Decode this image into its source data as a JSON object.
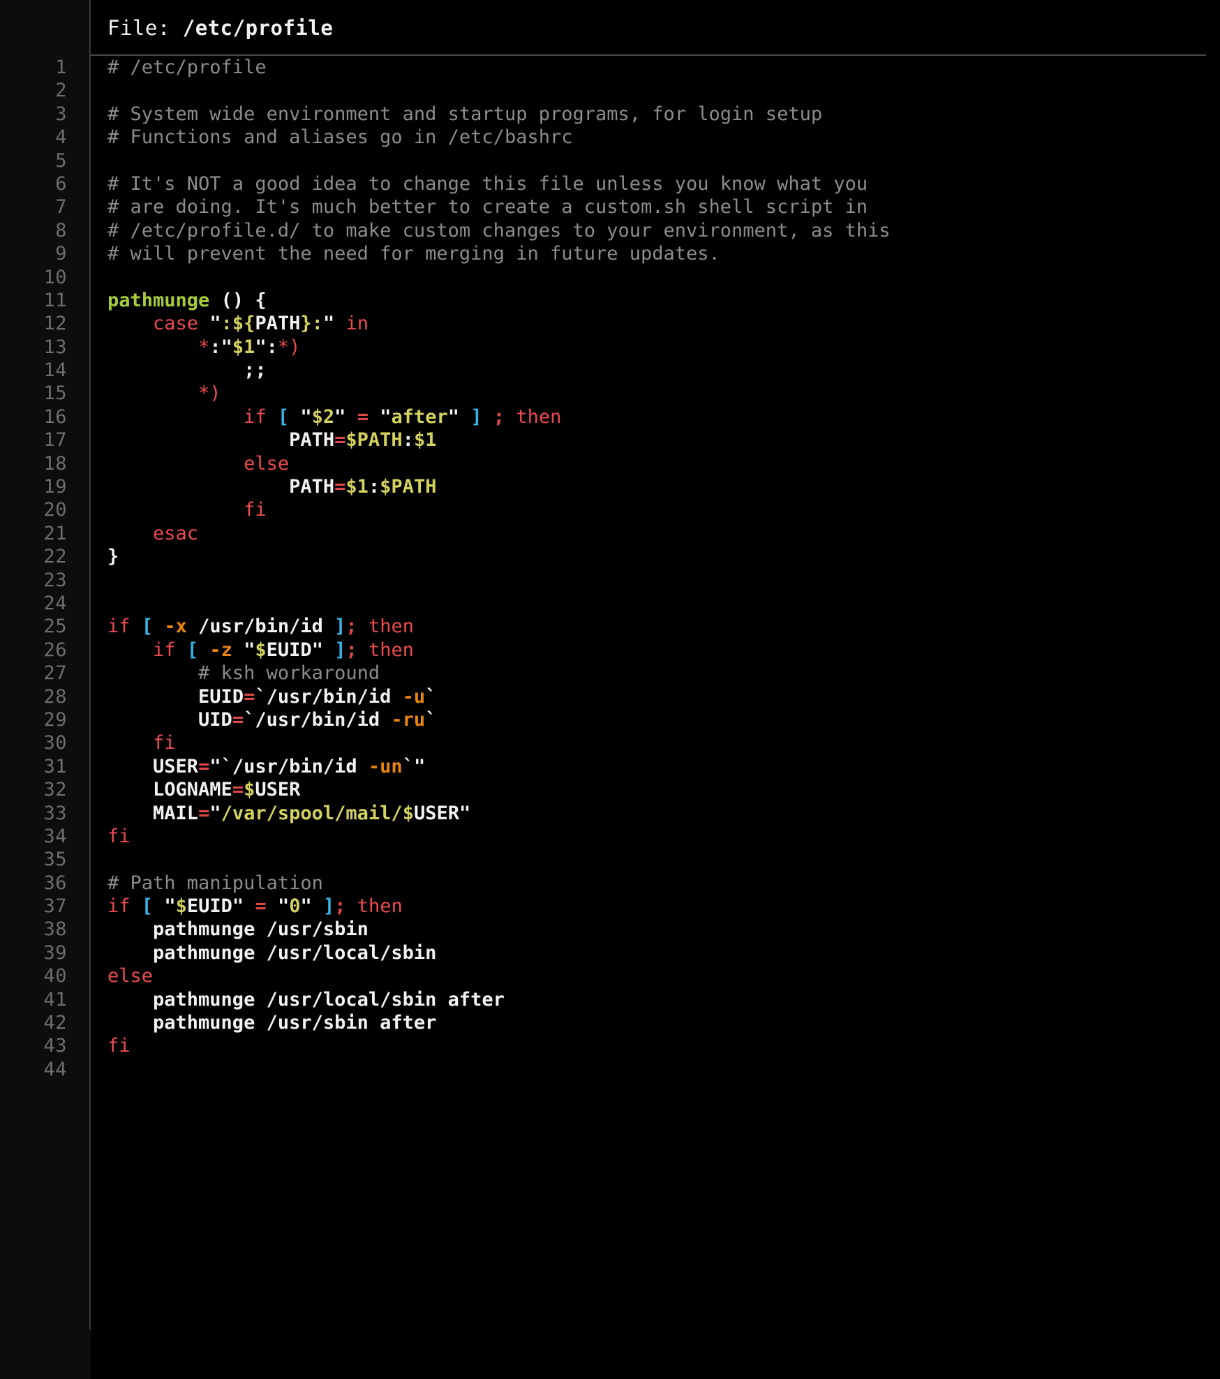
{
  "header": {
    "label": "File: ",
    "path": "/etc/profile",
    "full": "File: /etc/profile"
  },
  "theme": {
    "page_background": "#000000",
    "gutter_background": "#0d0d0d",
    "gutter_rule": "#3a3a3a",
    "header_rule": "#4a4a4a",
    "line_number": "#6e6e6e",
    "comment": "#8c8c8c",
    "plain_text": "#f2f2f2",
    "function_name": "#a6cd38",
    "keyword": "#ed4a50",
    "string": "#d4d25e",
    "variable_sigil": "#d4d25e",
    "bracket": "#35b5e8",
    "operator": "#e04848",
    "flag": "#e88410"
  },
  "editor": {
    "first_line": 1,
    "last_line": 44,
    "total_lines": 44,
    "language": "bash"
  },
  "line_numbers": [
    "1",
    "2",
    "3",
    "4",
    "5",
    "6",
    "7",
    "8",
    "9",
    "10",
    "11",
    "12",
    "13",
    "14",
    "15",
    "16",
    "17",
    "18",
    "19",
    "20",
    "21",
    "22",
    "23",
    "24",
    "25",
    "26",
    "27",
    "28",
    "29",
    "30",
    "31",
    "32",
    "33",
    "34",
    "35",
    "36",
    "37",
    "38",
    "39",
    "40",
    "41",
    "42",
    "43",
    "44"
  ],
  "lines": [
    {
      "n": 1,
      "text": "# /etc/profile",
      "tokens": [
        {
          "t": "# /etc/profile",
          "c": "comment"
        }
      ]
    },
    {
      "n": 2,
      "text": "",
      "tokens": []
    },
    {
      "n": 3,
      "text": "# System wide environment and startup programs, for login setup",
      "tokens": [
        {
          "t": "# System wide environment and startup programs, for login setup",
          "c": "comment"
        }
      ]
    },
    {
      "n": 4,
      "text": "# Functions and aliases go in /etc/bashrc",
      "tokens": [
        {
          "t": "# Functions and aliases go in /etc/bashrc",
          "c": "comment"
        }
      ]
    },
    {
      "n": 5,
      "text": "",
      "tokens": []
    },
    {
      "n": 6,
      "text": "# It's NOT a good idea to change this file unless you know what you",
      "tokens": [
        {
          "t": "# It's NOT a good idea to change this file unless you know what you",
          "c": "comment"
        }
      ]
    },
    {
      "n": 7,
      "text": "# are doing. It's much better to create a custom.sh shell script in",
      "tokens": [
        {
          "t": "# are doing. It's much better to create a custom.sh shell script in",
          "c": "comment"
        }
      ]
    },
    {
      "n": 8,
      "text": "# /etc/profile.d/ to make custom changes to your environment, as this",
      "tokens": [
        {
          "t": "# /etc/profile.d/ to make custom changes to your environment, as this",
          "c": "comment"
        }
      ]
    },
    {
      "n": 9,
      "text": "# will prevent the need for merging in future updates.",
      "tokens": [
        {
          "t": "# will prevent the need for merging in future updates.",
          "c": "comment"
        }
      ]
    },
    {
      "n": 10,
      "text": "",
      "tokens": []
    },
    {
      "n": 11,
      "text": "pathmunge () {",
      "tokens": [
        {
          "t": "pathmunge",
          "c": "func"
        },
        {
          "t": " () {",
          "c": "plain"
        }
      ]
    },
    {
      "n": 12,
      "text": "    case \":${PATH}:\" in",
      "tokens": [
        {
          "t": "    ",
          "c": "plain"
        },
        {
          "t": "case",
          "c": "kw"
        },
        {
          "t": " ",
          "c": "plain"
        },
        {
          "t": "\"",
          "c": "plain"
        },
        {
          "t": ":",
          "c": "str"
        },
        {
          "t": "${",
          "c": "var"
        },
        {
          "t": "PATH",
          "c": "plain"
        },
        {
          "t": "}",
          "c": "var"
        },
        {
          "t": ":",
          "c": "str"
        },
        {
          "t": "\"",
          "c": "plain"
        },
        {
          "t": " ",
          "c": "plain"
        },
        {
          "t": "in",
          "c": "kw"
        }
      ]
    },
    {
      "n": 13,
      "text": "        *:\"$1\":*)",
      "tokens": [
        {
          "t": "        ",
          "c": "plain"
        },
        {
          "t": "*",
          "c": "kw"
        },
        {
          "t": ":",
          "c": "plain"
        },
        {
          "t": "\"",
          "c": "plain"
        },
        {
          "t": "$1",
          "c": "var"
        },
        {
          "t": "\"",
          "c": "plain"
        },
        {
          "t": ":",
          "c": "plain"
        },
        {
          "t": "*)",
          "c": "kw"
        }
      ]
    },
    {
      "n": 14,
      "text": "            ;;",
      "tokens": [
        {
          "t": "            ",
          "c": "plain"
        },
        {
          "t": ";;",
          "c": "punct"
        }
      ]
    },
    {
      "n": 15,
      "text": "        *)",
      "tokens": [
        {
          "t": "        ",
          "c": "plain"
        },
        {
          "t": "*)",
          "c": "kw"
        }
      ]
    },
    {
      "n": 16,
      "text": "            if [ \"$2\" = \"after\" ] ; then",
      "tokens": [
        {
          "t": "            ",
          "c": "plain"
        },
        {
          "t": "if",
          "c": "kw"
        },
        {
          "t": " ",
          "c": "plain"
        },
        {
          "t": "[",
          "c": "brk"
        },
        {
          "t": " ",
          "c": "plain"
        },
        {
          "t": "\"",
          "c": "plain"
        },
        {
          "t": "$2",
          "c": "var"
        },
        {
          "t": "\"",
          "c": "plain"
        },
        {
          "t": " ",
          "c": "plain"
        },
        {
          "t": "=",
          "c": "op"
        },
        {
          "t": " ",
          "c": "plain"
        },
        {
          "t": "\"",
          "c": "plain"
        },
        {
          "t": "after",
          "c": "str"
        },
        {
          "t": "\"",
          "c": "plain"
        },
        {
          "t": " ",
          "c": "plain"
        },
        {
          "t": "]",
          "c": "brk"
        },
        {
          "t": " ",
          "c": "plain"
        },
        {
          "t": ";",
          "c": "op"
        },
        {
          "t": " ",
          "c": "plain"
        },
        {
          "t": "then",
          "c": "kw"
        }
      ]
    },
    {
      "n": 17,
      "text": "                PATH=$PATH:$1",
      "tokens": [
        {
          "t": "                ",
          "c": "plain"
        },
        {
          "t": "PATH",
          "c": "plain"
        },
        {
          "t": "=",
          "c": "op"
        },
        {
          "t": "$PATH",
          "c": "var"
        },
        {
          "t": ":",
          "c": "plain"
        },
        {
          "t": "$1",
          "c": "var"
        }
      ]
    },
    {
      "n": 18,
      "text": "            else",
      "tokens": [
        {
          "t": "            ",
          "c": "plain"
        },
        {
          "t": "else",
          "c": "kw"
        }
      ]
    },
    {
      "n": 19,
      "text": "                PATH=$1:$PATH",
      "tokens": [
        {
          "t": "                ",
          "c": "plain"
        },
        {
          "t": "PATH",
          "c": "plain"
        },
        {
          "t": "=",
          "c": "op"
        },
        {
          "t": "$1",
          "c": "var"
        },
        {
          "t": ":",
          "c": "plain"
        },
        {
          "t": "$PATH",
          "c": "var"
        }
      ]
    },
    {
      "n": 20,
      "text": "            fi",
      "tokens": [
        {
          "t": "            ",
          "c": "plain"
        },
        {
          "t": "fi",
          "c": "kw"
        }
      ]
    },
    {
      "n": 21,
      "text": "    esac",
      "tokens": [
        {
          "t": "    ",
          "c": "plain"
        },
        {
          "t": "esac",
          "c": "kw"
        }
      ]
    },
    {
      "n": 22,
      "text": "}",
      "tokens": [
        {
          "t": "}",
          "c": "plain"
        }
      ]
    },
    {
      "n": 23,
      "text": "",
      "tokens": []
    },
    {
      "n": 24,
      "text": "",
      "tokens": []
    },
    {
      "n": 25,
      "text": "if [ -x /usr/bin/id ]; then",
      "tokens": [
        {
          "t": "if",
          "c": "kw"
        },
        {
          "t": " ",
          "c": "plain"
        },
        {
          "t": "[",
          "c": "brk"
        },
        {
          "t": " ",
          "c": "plain"
        },
        {
          "t": "-x",
          "c": "flag"
        },
        {
          "t": " /usr/bin/id ",
          "c": "plain"
        },
        {
          "t": "]",
          "c": "brk"
        },
        {
          "t": ";",
          "c": "op"
        },
        {
          "t": " ",
          "c": "plain"
        },
        {
          "t": "then",
          "c": "kw"
        }
      ]
    },
    {
      "n": 26,
      "text": "    if [ -z \"$EUID\" ]; then",
      "tokens": [
        {
          "t": "    ",
          "c": "plain"
        },
        {
          "t": "if",
          "c": "kw"
        },
        {
          "t": " ",
          "c": "plain"
        },
        {
          "t": "[",
          "c": "brk"
        },
        {
          "t": " ",
          "c": "plain"
        },
        {
          "t": "-z",
          "c": "flag"
        },
        {
          "t": " ",
          "c": "plain"
        },
        {
          "t": "\"",
          "c": "plain"
        },
        {
          "t": "$",
          "c": "var"
        },
        {
          "t": "EUID",
          "c": "plain"
        },
        {
          "t": "\"",
          "c": "plain"
        },
        {
          "t": " ",
          "c": "plain"
        },
        {
          "t": "]",
          "c": "brk"
        },
        {
          "t": ";",
          "c": "op"
        },
        {
          "t": " ",
          "c": "plain"
        },
        {
          "t": "then",
          "c": "kw"
        }
      ]
    },
    {
      "n": 27,
      "text": "        # ksh workaround",
      "tokens": [
        {
          "t": "        ",
          "c": "plain"
        },
        {
          "t": "# ksh workaround",
          "c": "comment"
        }
      ]
    },
    {
      "n": 28,
      "text": "        EUID=`/usr/bin/id -u`",
      "tokens": [
        {
          "t": "        ",
          "c": "plain"
        },
        {
          "t": "EUID",
          "c": "plain"
        },
        {
          "t": "=",
          "c": "op"
        },
        {
          "t": "`/usr/bin/id ",
          "c": "plain"
        },
        {
          "t": "-u",
          "c": "flag"
        },
        {
          "t": "`",
          "c": "plain"
        }
      ]
    },
    {
      "n": 29,
      "text": "        UID=`/usr/bin/id -ru`",
      "tokens": [
        {
          "t": "        ",
          "c": "plain"
        },
        {
          "t": "UID",
          "c": "plain"
        },
        {
          "t": "=",
          "c": "op"
        },
        {
          "t": "`/usr/bin/id ",
          "c": "plain"
        },
        {
          "t": "-ru",
          "c": "flag"
        },
        {
          "t": "`",
          "c": "plain"
        }
      ]
    },
    {
      "n": 30,
      "text": "    fi",
      "tokens": [
        {
          "t": "    ",
          "c": "plain"
        },
        {
          "t": "fi",
          "c": "kw"
        }
      ]
    },
    {
      "n": 31,
      "text": "    USER=\"`/usr/bin/id -un`\"",
      "tokens": [
        {
          "t": "    ",
          "c": "plain"
        },
        {
          "t": "USER",
          "c": "plain"
        },
        {
          "t": "=",
          "c": "op"
        },
        {
          "t": "\"`/usr/bin/id ",
          "c": "plain"
        },
        {
          "t": "-un",
          "c": "flag"
        },
        {
          "t": "`\"",
          "c": "plain"
        }
      ]
    },
    {
      "n": 32,
      "text": "    LOGNAME=$USER",
      "tokens": [
        {
          "t": "    ",
          "c": "plain"
        },
        {
          "t": "LOGNAME",
          "c": "plain"
        },
        {
          "t": "=",
          "c": "op"
        },
        {
          "t": "$",
          "c": "var"
        },
        {
          "t": "USER",
          "c": "plain"
        }
      ]
    },
    {
      "n": 33,
      "text": "    MAIL=\"/var/spool/mail/$USER\"",
      "tokens": [
        {
          "t": "    ",
          "c": "plain"
        },
        {
          "t": "MAIL",
          "c": "plain"
        },
        {
          "t": "=",
          "c": "op"
        },
        {
          "t": "\"",
          "c": "plain"
        },
        {
          "t": "/var/spool/mail/",
          "c": "str"
        },
        {
          "t": "$",
          "c": "var"
        },
        {
          "t": "USER",
          "c": "plain"
        },
        {
          "t": "\"",
          "c": "plain"
        }
      ]
    },
    {
      "n": 34,
      "text": "fi",
      "tokens": [
        {
          "t": "fi",
          "c": "kw"
        }
      ]
    },
    {
      "n": 35,
      "text": "",
      "tokens": []
    },
    {
      "n": 36,
      "text": "# Path manipulation",
      "tokens": [
        {
          "t": "# Path manipulation",
          "c": "comment"
        }
      ]
    },
    {
      "n": 37,
      "text": "if [ \"$EUID\" = \"0\" ]; then",
      "tokens": [
        {
          "t": "if",
          "c": "kw"
        },
        {
          "t": " ",
          "c": "plain"
        },
        {
          "t": "[",
          "c": "brk"
        },
        {
          "t": " ",
          "c": "plain"
        },
        {
          "t": "\"",
          "c": "plain"
        },
        {
          "t": "$",
          "c": "var"
        },
        {
          "t": "EUID",
          "c": "plain"
        },
        {
          "t": "\"",
          "c": "plain"
        },
        {
          "t": " ",
          "c": "plain"
        },
        {
          "t": "=",
          "c": "op"
        },
        {
          "t": " ",
          "c": "plain"
        },
        {
          "t": "\"",
          "c": "plain"
        },
        {
          "t": "0",
          "c": "str"
        },
        {
          "t": "\"",
          "c": "plain"
        },
        {
          "t": " ",
          "c": "plain"
        },
        {
          "t": "]",
          "c": "brk"
        },
        {
          "t": ";",
          "c": "op"
        },
        {
          "t": " ",
          "c": "plain"
        },
        {
          "t": "then",
          "c": "kw"
        }
      ]
    },
    {
      "n": 38,
      "text": "    pathmunge /usr/sbin",
      "tokens": [
        {
          "t": "    pathmunge /usr/sbin",
          "c": "plain"
        }
      ]
    },
    {
      "n": 39,
      "text": "    pathmunge /usr/local/sbin",
      "tokens": [
        {
          "t": "    pathmunge /usr/local/sbin",
          "c": "plain"
        }
      ]
    },
    {
      "n": 40,
      "text": "else",
      "tokens": [
        {
          "t": "else",
          "c": "kw"
        }
      ]
    },
    {
      "n": 41,
      "text": "    pathmunge /usr/local/sbin after",
      "tokens": [
        {
          "t": "    pathmunge /usr/local/sbin after",
          "c": "plain"
        }
      ]
    },
    {
      "n": 42,
      "text": "    pathmunge /usr/sbin after",
      "tokens": [
        {
          "t": "    pathmunge /usr/sbin after",
          "c": "plain"
        }
      ]
    },
    {
      "n": 43,
      "text": "fi",
      "tokens": [
        {
          "t": "fi",
          "c": "kw"
        }
      ]
    },
    {
      "n": 44,
      "text": "",
      "tokens": []
    }
  ]
}
